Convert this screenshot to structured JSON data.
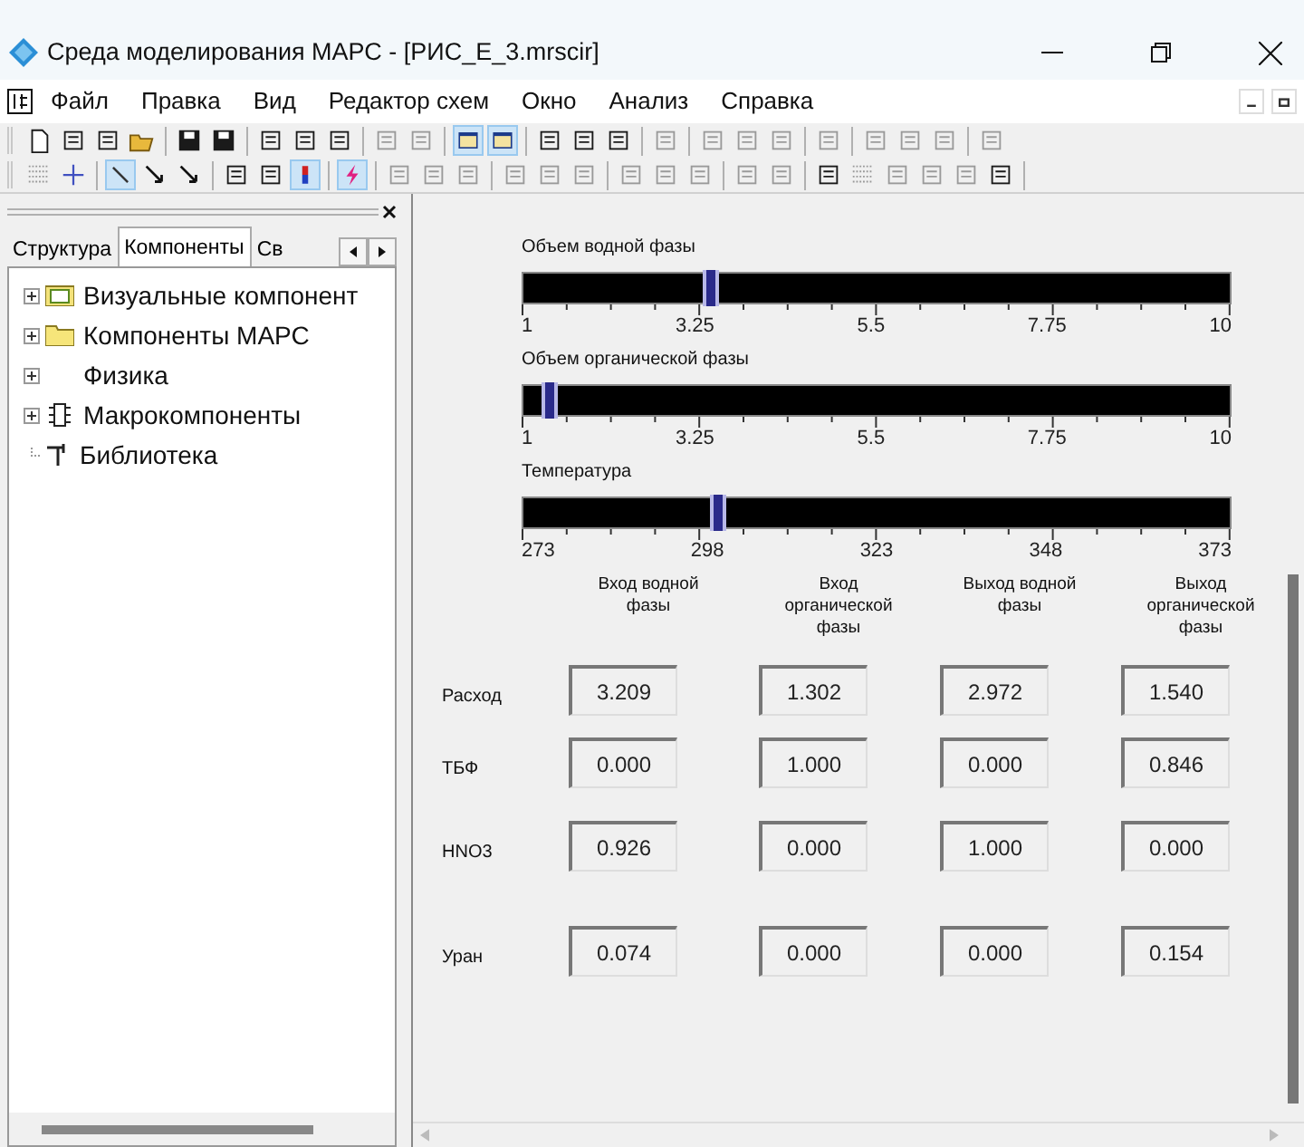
{
  "window": {
    "title": "Среда моделирования МАРС - [РИС_Е_3.mrscir]"
  },
  "menu": [
    "Файл",
    "Правка",
    "Вид",
    "Редактор схем",
    "Окно",
    "Анализ",
    "Справка"
  ],
  "toolbar_1": [
    {
      "pressed": false
    },
    {
      "pressed": false
    },
    {
      "pressed": false
    },
    {
      "pressed": false
    },
    {
      "pressed": false
    },
    {
      "pressed": false
    },
    {
      "pressed": false
    },
    {
      "pressed": false
    },
    {
      "pressed": false
    },
    {
      "pressed": false
    },
    {
      "pressed": false
    },
    {
      "pressed": true
    },
    {
      "pressed": true
    },
    {
      "pressed": false
    },
    {
      "pressed": false
    },
    {
      "pressed": false
    },
    {
      "pressed": false
    },
    {
      "pressed": false
    },
    {
      "pressed": false
    },
    {
      "pressed": false
    },
    {
      "pressed": false
    },
    {
      "pressed": false
    },
    {
      "pressed": false
    },
    {
      "pressed": false
    },
    {
      "pressed": false
    }
  ],
  "toolbar_2": [
    {
      "pressed": false
    },
    {
      "pressed": false
    },
    {
      "pressed": true
    },
    {
      "pressed": false
    },
    {
      "pressed": false
    },
    {
      "pressed": false
    },
    {
      "pressed": false
    },
    {
      "pressed": true
    },
    {
      "pressed": true
    },
    {
      "pressed": false
    },
    {
      "pressed": false
    },
    {
      "pressed": false
    },
    {
      "pressed": false
    },
    {
      "pressed": false
    },
    {
      "pressed": false
    },
    {
      "pressed": false
    },
    {
      "pressed": false
    },
    {
      "pressed": false
    },
    {
      "pressed": false
    },
    {
      "pressed": false
    },
    {
      "pressed": false
    },
    {
      "pressed": false
    },
    {
      "pressed": false
    },
    {
      "pressed": false
    },
    {
      "pressed": false
    },
    {
      "pressed": false
    }
  ],
  "sidebar": {
    "tabs": [
      {
        "label": "Структура",
        "selected": false
      },
      {
        "label": "Компоненты",
        "selected": true
      },
      {
        "label": "Св",
        "selected": false
      }
    ],
    "tree": [
      {
        "label": "Визуальные компонент",
        "kind": "vc",
        "expandable": true
      },
      {
        "label": "Компоненты МАРС",
        "kind": "folder",
        "expandable": true
      },
      {
        "label": "Физика",
        "kind": "blank",
        "expandable": true
      },
      {
        "label": "Макрокомпоненты",
        "kind": "chip",
        "expandable": true
      },
      {
        "label": "Библиотека",
        "kind": "lib",
        "expandable": false
      }
    ]
  },
  "sliders": [
    {
      "label": "Объем водной фазы",
      "level": 0.26,
      "ticks": [
        "1",
        "3.25",
        "5.5",
        "7.75",
        "10"
      ]
    },
    {
      "label": "Объем органической фазы",
      "level": 0.03,
      "ticks": [
        "1",
        "3.25",
        "5.5",
        "7.75",
        "10"
      ]
    },
    {
      "label": "Температура",
      "level": 0.27,
      "ticks": [
        "273",
        "298",
        "323",
        "348",
        "373"
      ]
    }
  ],
  "table": {
    "columns": [
      "Вход водной фазы",
      "Вход органической фазы",
      "Выход водной фазы",
      "Выход органической фазы"
    ],
    "rows": [
      {
        "label": "Расход",
        "values": [
          "3.209",
          "1.302",
          "2.972",
          "1.540"
        ]
      },
      {
        "label": "ТБФ",
        "values": [
          "0.000",
          "1.000",
          "0.000",
          "0.846"
        ]
      },
      {
        "label": "HNO3",
        "values": [
          "0.926",
          "0.000",
          "1.000",
          "0.000"
        ]
      },
      {
        "label": "Уран",
        "values": [
          "0.074",
          "0.000",
          "0.000",
          "0.154"
        ]
      }
    ]
  }
}
